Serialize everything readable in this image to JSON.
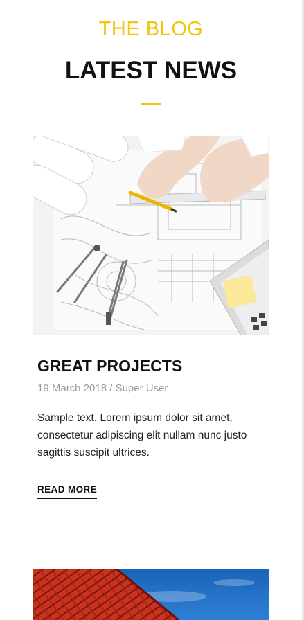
{
  "header": {
    "kicker": "THE BLOG",
    "title": "LATEST NEWS",
    "accent_color": "#f1c40f"
  },
  "posts": [
    {
      "image_icon": "architect-blueprint-image",
      "title": "GREAT PROJECTS",
      "meta": "19 March 2018 / Super User",
      "excerpt": "Sample text. Lorem ipsum dolor sit amet, consectetur adipiscing elit nullam nunc justo sagittis suscipit ultrices.",
      "read_more_label": "READ MORE"
    },
    {
      "image_icon": "red-roof-sky-image"
    }
  ]
}
